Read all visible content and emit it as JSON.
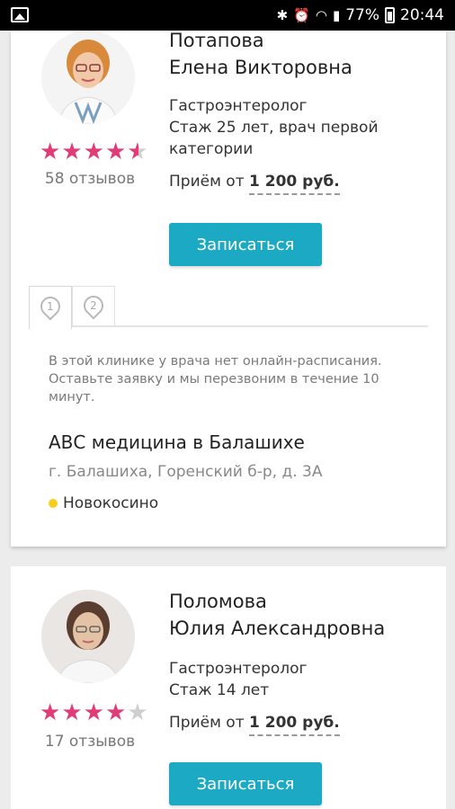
{
  "status_bar": {
    "battery_text": "77%",
    "time": "20:44",
    "icons": [
      "gallery-icon",
      "bluetooth-icon",
      "alarm-icon",
      "wifi-icon",
      "signal-icon",
      "battery-icon"
    ]
  },
  "doctors": [
    {
      "name_line1": "Потапова",
      "name_line2": "Елена Викторовна",
      "specialty": "Гастроэнтеролог",
      "experience_line1": "Стаж 25 лет, врач первой",
      "experience_line2": "категории",
      "price_label": "Приём от",
      "price_value": "1 200 руб.",
      "rating": 4.5,
      "reviews": "58 отзывов",
      "book_label": "Записаться"
    },
    {
      "name_line1": "Поломова",
      "name_line2": "Юлия Александровна",
      "specialty": "Гастроэнтеролог",
      "experience_line1": "Стаж 14 лет",
      "price_label": "Приём от",
      "price_value": "1 200 руб.",
      "rating": 4,
      "reviews": "17 отзывов",
      "book_label": "Записаться"
    }
  ],
  "clinic_tabs": [
    "1",
    "2"
  ],
  "clinic": {
    "notice_line1": "В этой клинике у врача нет онлайн-расписания.",
    "notice_line2": "Оставьте заявку и мы перезвоним в течение 10",
    "notice_line3": "минут.",
    "name": "АВС медицина в Балашихе",
    "address": "г. Балашиха, Горенский б-р, д. 3А",
    "metro": "Новокосино",
    "metro_color": "#f5cf1b"
  },
  "colors": {
    "accent": "#1ca9c4",
    "stars": "#e23c78"
  }
}
